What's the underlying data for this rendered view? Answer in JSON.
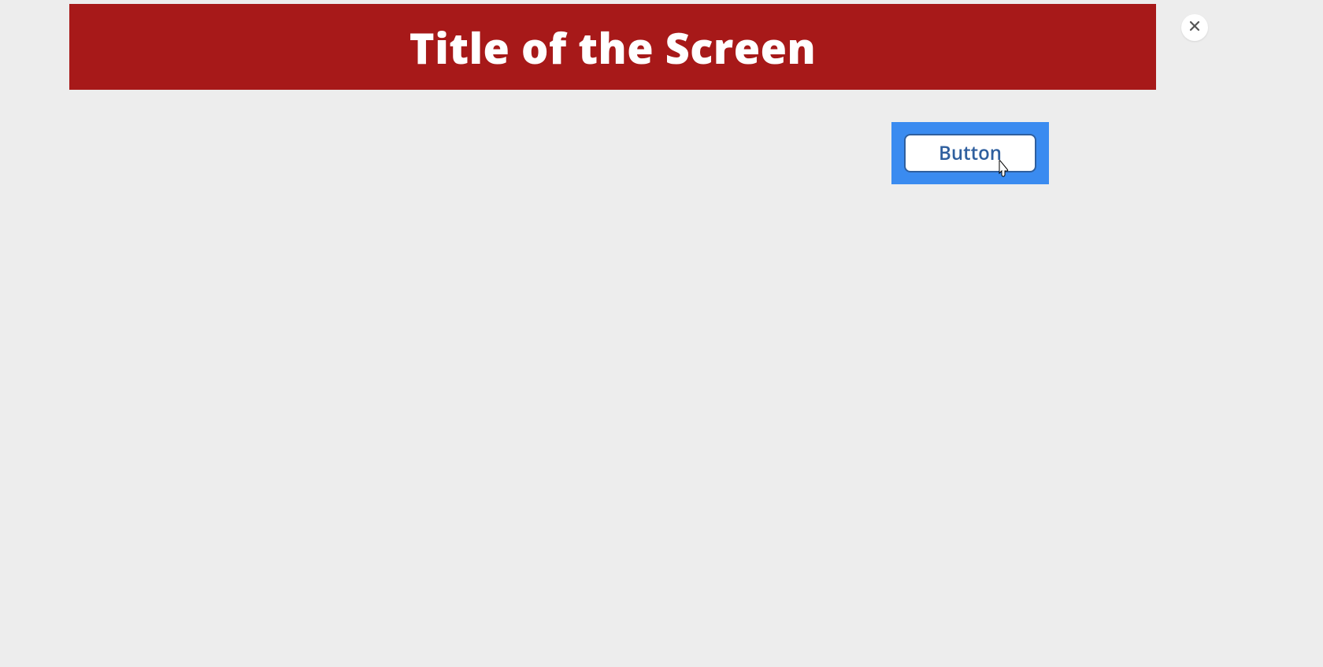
{
  "header": {
    "title": "Title of the Screen"
  },
  "content": {
    "action_button_label": "Button"
  },
  "controls": {
    "close_label": "Close"
  },
  "colors": {
    "brand_red": "#a71919",
    "highlight_blue": "#3a8bf0",
    "button_blue": "#2f5f9e"
  }
}
